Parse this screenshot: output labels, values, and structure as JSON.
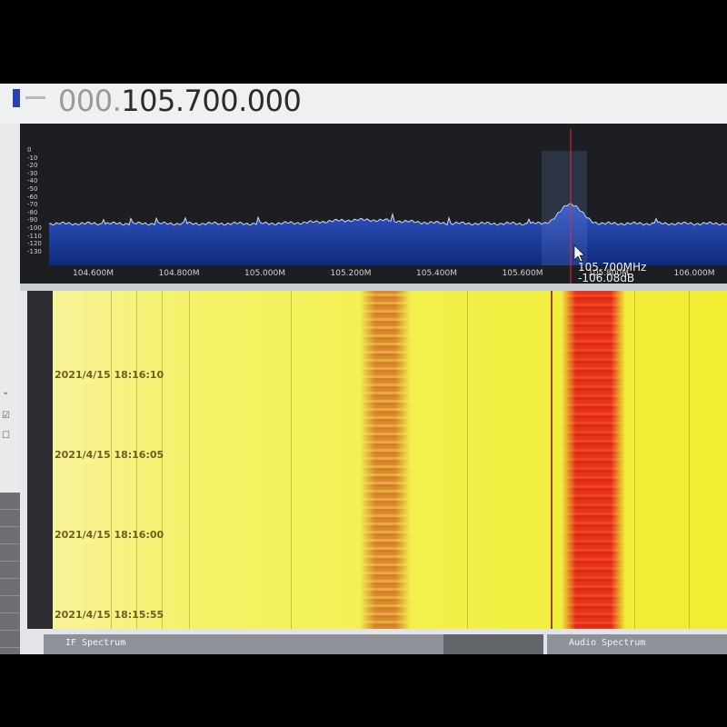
{
  "frequency": {
    "lead": "000.",
    "main": "105.700.000"
  },
  "spectrum": {
    "y_ticks": [
      "0",
      "-10",
      "-20",
      "-30",
      "-40",
      "-50",
      "-60",
      "-70",
      "-80",
      "-90",
      "-100",
      "-110",
      "-120",
      "-130"
    ],
    "x_ticks": [
      "104.600M",
      "104.800M",
      "105.000M",
      "105.200M",
      "105.400M",
      "105.600M",
      "105.800M",
      "106.000M"
    ],
    "cursor": {
      "freq": "105.700MHz",
      "level": "-106.08dB"
    },
    "colors": {
      "background": "#1c1e21",
      "fill": "#1f44a8",
      "trace": "#cfd8ff",
      "cursor": "#e03030"
    }
  },
  "waterfall": {
    "timestamps": [
      "2021/4/15 18:16:10",
      "2021/4/15 18:16:05",
      "2021/4/15 18:16:00",
      "2021/4/15 18:15:55"
    ],
    "colors": {
      "low": "#f2f03a",
      "high": "#e8321c"
    }
  },
  "panels": {
    "if_title": "IF Spectrum",
    "audio_title": "Audio Spectrum"
  },
  "sidebar": {
    "check_on": "☑",
    "check_off": "☐",
    "arrow": "⌄"
  }
}
